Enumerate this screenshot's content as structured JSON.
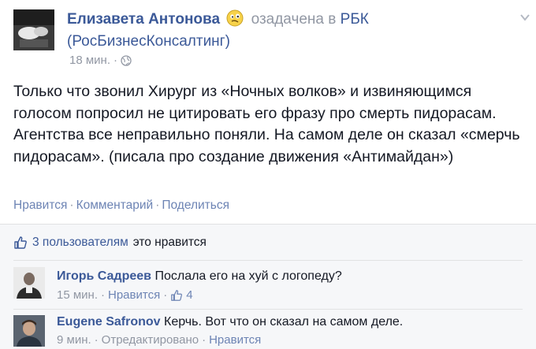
{
  "post": {
    "author_name": "Елизавета Антонова",
    "feeling": "озадачена в",
    "page_short": "РБК",
    "page_full": "(РосБизнесКонсалтинг)",
    "time": "18 мин.",
    "meta_sep": "·",
    "text": "Только что звонил Хирург из «Ночных волков» и извиняющимся голосом попросил не цитировать его фразу про смерть пидорасам. Агентства все неправильно поняли. На самом деле он сказал «смерчь пидорасам». (писала про создание движения «Антимайдан»)",
    "actions": {
      "like": "Нравится",
      "comment": "Комментарий",
      "share": "Поделиться",
      "sep": "·"
    },
    "likes": {
      "count_text": "3 пользователям",
      "rest_text": "это нравится"
    }
  },
  "comments": [
    {
      "author": "Игорь Садреев",
      "text": "Послала его на хуй с логопеду?",
      "time": "15 мин.",
      "like": "Нравится",
      "like_count": "4",
      "sep": "·"
    },
    {
      "author": "Eugene Safronov",
      "text": "Керчь. Вот что он сказал на самом деле.",
      "time": "9 мин.",
      "edited": "Отредактировано",
      "like": "Нравится",
      "sep": "·"
    }
  ],
  "icons": {
    "feeling": "confused-emoji-icon",
    "privacy": "globe-icon",
    "menu": "chevron-down-icon",
    "like": "thumbs-up-icon"
  },
  "colors": {
    "link": "#3b5998",
    "muted": "#9197a3",
    "action": "#6d84b4",
    "text": "#141823",
    "panel": "#f6f7f9"
  }
}
